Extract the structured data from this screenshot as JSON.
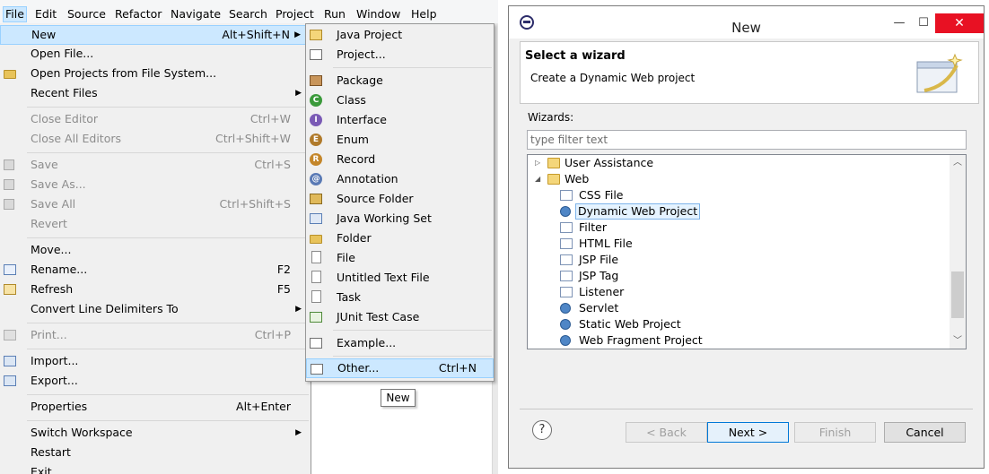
{
  "menubar": [
    "File",
    "Edit",
    "Source",
    "Refactor",
    "Navigate",
    "Search",
    "Project",
    "Run",
    "Window",
    "Help"
  ],
  "file_menu": [
    {
      "label": "New",
      "accel": "Alt+Shift+N",
      "submenu": true,
      "state": "highlighted"
    },
    {
      "label": "Open File...",
      "accel": ""
    },
    {
      "label": "Open Projects from File System...",
      "accel": "",
      "icon": "folder-open-icon"
    },
    {
      "label": "Recent Files",
      "accel": "",
      "submenu": true
    },
    {
      "label": "Close Editor",
      "accel": "Ctrl+W",
      "state": "disabled"
    },
    {
      "label": "Close All Editors",
      "accel": "Ctrl+Shift+W",
      "state": "disabled"
    },
    {
      "label": "Save",
      "accel": "Ctrl+S",
      "state": "disabled",
      "icon": "save-icon"
    },
    {
      "label": "Save As...",
      "accel": "",
      "state": "disabled",
      "icon": "save-as-icon"
    },
    {
      "label": "Save All",
      "accel": "Ctrl+Shift+S",
      "state": "disabled",
      "icon": "save-all-icon"
    },
    {
      "label": "Revert",
      "accel": "",
      "state": "disabled"
    },
    {
      "label": "Move...",
      "accel": ""
    },
    {
      "label": "Rename...",
      "accel": "F2",
      "icon": "rename-icon"
    },
    {
      "label": "Refresh",
      "accel": "F5",
      "icon": "refresh-icon"
    },
    {
      "label": "Convert Line Delimiters To",
      "accel": "",
      "submenu": true
    },
    {
      "label": "Print...",
      "accel": "Ctrl+P",
      "state": "disabled",
      "icon": "print-icon"
    },
    {
      "label": "Import...",
      "accel": "",
      "icon": "import-icon"
    },
    {
      "label": "Export...",
      "accel": "",
      "icon": "export-icon"
    },
    {
      "label": "Properties",
      "accel": "Alt+Enter"
    },
    {
      "label": "Switch Workspace",
      "accel": "",
      "submenu": true
    },
    {
      "label": "Restart",
      "accel": ""
    },
    {
      "label": "Exit",
      "accel": ""
    }
  ],
  "new_menu": [
    {
      "label": "Java Project",
      "accel": "",
      "icon": "java-project-icon"
    },
    {
      "label": "Project...",
      "accel": "",
      "icon": "project-icon"
    },
    {
      "label": "Package",
      "accel": "",
      "icon": "package-icon"
    },
    {
      "label": "Class",
      "accel": "",
      "icon": "class-icon"
    },
    {
      "label": "Interface",
      "accel": "",
      "icon": "interface-icon"
    },
    {
      "label": "Enum",
      "accel": "",
      "icon": "enum-icon"
    },
    {
      "label": "Record",
      "accel": "",
      "icon": "record-icon"
    },
    {
      "label": "Annotation",
      "accel": "",
      "icon": "annotation-icon"
    },
    {
      "label": "Source Folder",
      "accel": "",
      "icon": "source-folder-icon"
    },
    {
      "label": "Java Working Set",
      "accel": "",
      "icon": "working-set-icon"
    },
    {
      "label": "Folder",
      "accel": "",
      "icon": "folder-icon"
    },
    {
      "label": "File",
      "accel": "",
      "icon": "file-icon"
    },
    {
      "label": "Untitled Text File",
      "accel": "",
      "icon": "text-file-icon"
    },
    {
      "label": "Task",
      "accel": "",
      "icon": "task-icon"
    },
    {
      "label": "JUnit Test Case",
      "accel": "",
      "icon": "junit-icon"
    },
    {
      "label": "Example...",
      "accel": "",
      "icon": "example-icon"
    },
    {
      "label": "Other...",
      "accel": "Ctrl+N",
      "icon": "other-wizard-icon",
      "state": "highlighted"
    }
  ],
  "tooltip": "New",
  "dialog": {
    "title": "New",
    "minimize": "—",
    "maximize": "☐",
    "close": "✕",
    "banner_title": "Select a wizard",
    "banner_desc": "Create a Dynamic Web project",
    "wizards_label": "Wizards:",
    "filter_placeholder": "type filter text",
    "tree": [
      {
        "label": "User Assistance",
        "level": 0,
        "expanded": false,
        "kind": "folder"
      },
      {
        "label": "Web",
        "level": 0,
        "expanded": true,
        "kind": "folder"
      },
      {
        "label": "CSS File",
        "level": 1,
        "kind": "item"
      },
      {
        "label": "Dynamic Web Project",
        "level": 1,
        "kind": "globe",
        "selected": true
      },
      {
        "label": "Filter",
        "level": 1,
        "kind": "item"
      },
      {
        "label": "HTML File",
        "level": 1,
        "kind": "item"
      },
      {
        "label": "JSP File",
        "level": 1,
        "kind": "item"
      },
      {
        "label": "JSP Tag",
        "level": 1,
        "kind": "item"
      },
      {
        "label": "Listener",
        "level": 1,
        "kind": "item"
      },
      {
        "label": "Servlet",
        "level": 1,
        "kind": "globe"
      },
      {
        "label": "Static Web Project",
        "level": 1,
        "kind": "globe"
      },
      {
        "label": "Web Fragment Project",
        "level": 1,
        "kind": "globe"
      }
    ],
    "help": "?",
    "buttons": {
      "back": "< Back",
      "next": "Next >",
      "finish": "Finish",
      "cancel": "Cancel"
    }
  },
  "colors": {
    "highlight": "#cce8ff",
    "highlight_border": "#99d1ff",
    "close_red": "#e81123",
    "disabled_text": "#8c8c8c"
  }
}
